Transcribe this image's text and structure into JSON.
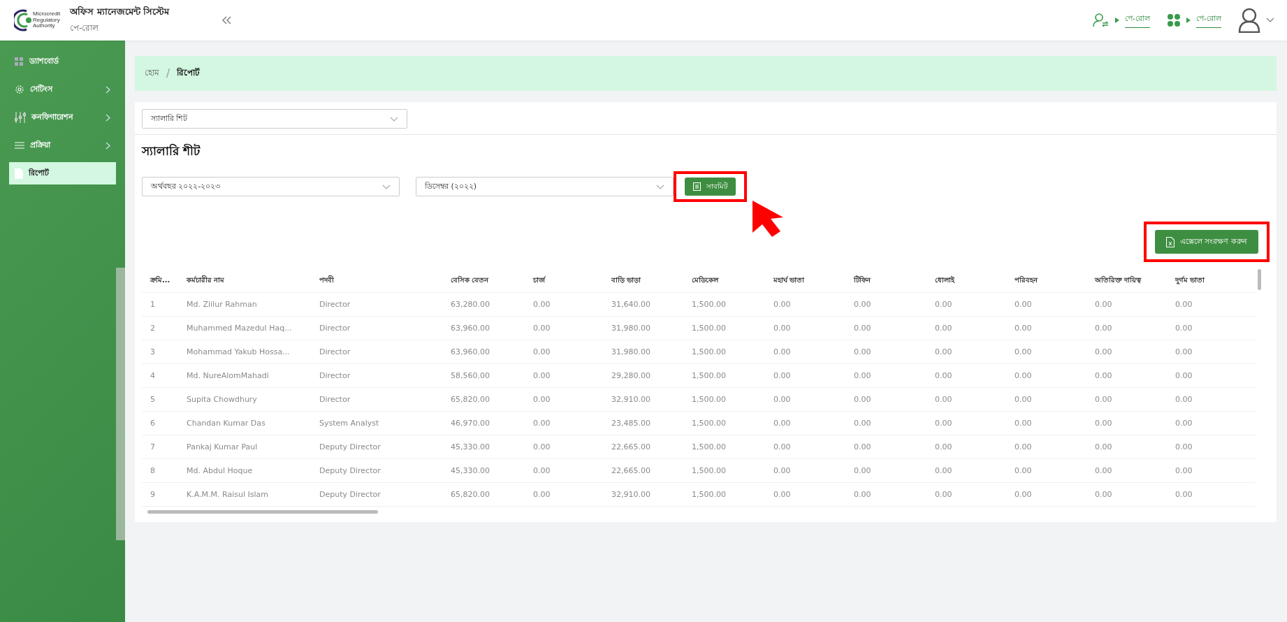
{
  "header": {
    "title": "অফিস ম্যানেজমেন্ট সিস্টেম",
    "subtitle": "পে-রোল",
    "links": [
      {
        "label": "পে-রোল"
      },
      {
        "label": "পে-রোল"
      }
    ]
  },
  "sidebar": {
    "items": [
      {
        "label": "ড্যাশবোর্ড",
        "expandable": false,
        "selected": false
      },
      {
        "label": "সেটিংস",
        "expandable": true,
        "selected": false
      },
      {
        "label": "কনফিগারেশন",
        "expandable": true,
        "selected": false
      },
      {
        "label": "প্রক্রিয়া",
        "expandable": true,
        "selected": false
      },
      {
        "label": "রিপোর্ট",
        "expandable": false,
        "selected": true
      }
    ]
  },
  "logo_text": [
    "Microcredit",
    "Regulatory",
    "Authority"
  ],
  "breadcrumb_separator": "/",
  "breadcrumb": [
    {
      "label": "হোম",
      "current": false
    },
    {
      "label": "রিপোর্ট",
      "current": true
    }
  ],
  "report_select": {
    "value": "স্যালারি শিট"
  },
  "section_title": "স্যালারি শীট",
  "filters": [
    {
      "value": "অর্থবছর ২০২২-২০২৩"
    },
    {
      "value": "ডিসেম্বর (২০২২)"
    }
  ],
  "submit_button": {
    "label": "সাবমিট"
  },
  "export_button": {
    "label": "এক্সেলে সংরক্ষণ করুন"
  },
  "table": {
    "columns": [
      "ক্রমি...",
      "কর্মচারীর নাম",
      "পদবী",
      "বেসিক বেতন",
      "চার্জ",
      "বাড়ি ভাড়া",
      "মেডিকেল",
      "মহার্ঘ ভাতা",
      "টিফিন",
      "ধোলাই",
      "পরিবহন",
      "অতিরিক্ত দায়িত্ব",
      "দুর্গম ভাতা"
    ],
    "rows": [
      [
        "1",
        "Md. Ziilur Rahman",
        "Director",
        "63,280.00",
        "0.00",
        "31,640.00",
        "1,500.00",
        "0.00",
        "0.00",
        "0.00",
        "0.00",
        "0.00",
        "0.00"
      ],
      [
        "2",
        "Muhammed Mazedul Haq...",
        "Director",
        "63,960.00",
        "0.00",
        "31,980.00",
        "1,500.00",
        "0.00",
        "0.00",
        "0.00",
        "0.00",
        "0.00",
        "0.00"
      ],
      [
        "3",
        "Mohammad Yakub Hossa...",
        "Director",
        "63,960.00",
        "0.00",
        "31,980.00",
        "1,500.00",
        "0.00",
        "0.00",
        "0.00",
        "0.00",
        "0.00",
        "0.00"
      ],
      [
        "4",
        "Md. NureAlomMahadi",
        "Director",
        "58,560.00",
        "0.00",
        "29,280.00",
        "1,500.00",
        "0.00",
        "0.00",
        "0.00",
        "0.00",
        "0.00",
        "0.00"
      ],
      [
        "5",
        "Supita Chowdhury",
        "Director",
        "65,820.00",
        "0.00",
        "32,910.00",
        "1,500.00",
        "0.00",
        "0.00",
        "0.00",
        "0.00",
        "0.00",
        "0.00"
      ],
      [
        "6",
        "Chandan Kumar Das",
        "System Analyst",
        "46,970.00",
        "0.00",
        "23,485.00",
        "1,500.00",
        "0.00",
        "0.00",
        "0.00",
        "0.00",
        "0.00",
        "0.00"
      ],
      [
        "7",
        "Pankaj Kumar Paul",
        "Deputy Director",
        "45,330.00",
        "0.00",
        "22,665.00",
        "1,500.00",
        "0.00",
        "0.00",
        "0.00",
        "0.00",
        "0.00",
        "0.00"
      ],
      [
        "8",
        "Md. Abdul Hoque",
        "Deputy Director",
        "45,330.00",
        "0.00",
        "22,665.00",
        "1,500.00",
        "0.00",
        "0.00",
        "0.00",
        "0.00",
        "0.00",
        "0.00"
      ],
      [
        "9",
        "K.A.M.M. Raisul Islam",
        "Deputy Director",
        "65,820.00",
        "0.00",
        "32,910.00",
        "1,500.00",
        "0.00",
        "0.00",
        "0.00",
        "0.00",
        "0.00",
        "0.00"
      ]
    ]
  }
}
